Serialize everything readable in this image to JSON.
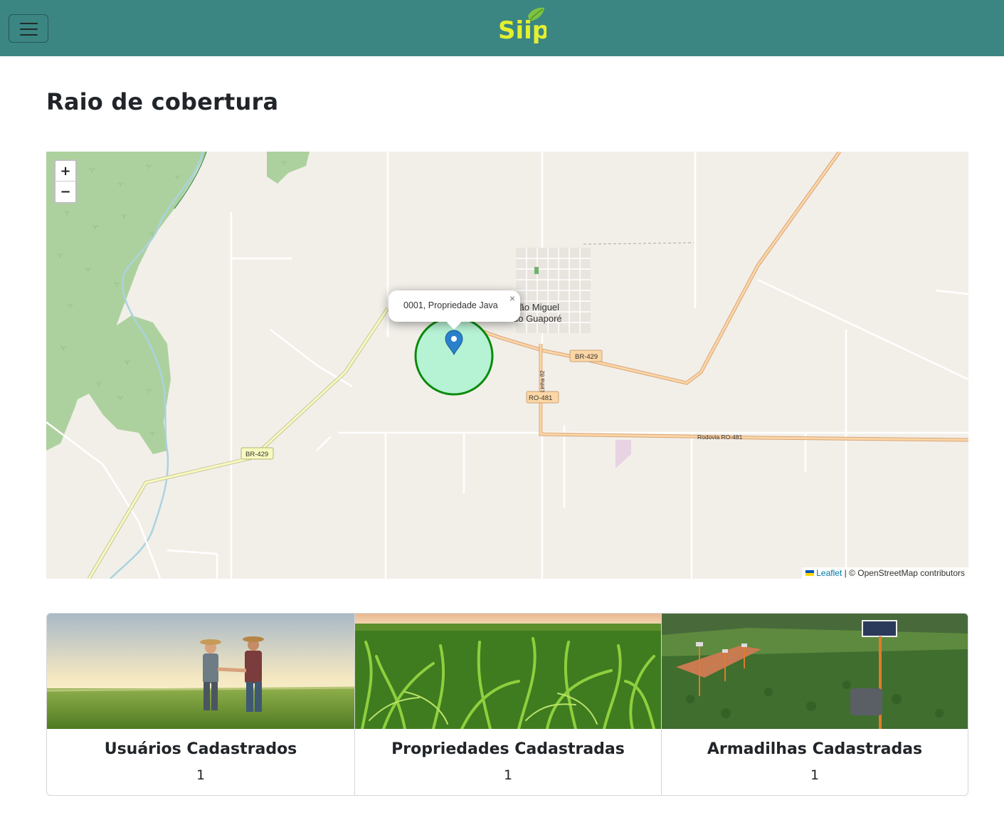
{
  "header": {
    "brand_name": "Siip",
    "menu_toggle_icon": "hamburger-menu-icon",
    "background_color": "#3b8683",
    "logo_color": "#e4ef2f",
    "leaf_color": "#7dc242"
  },
  "page": {
    "title": "Raio de cobertura"
  },
  "map": {
    "zoom_in_label": "+",
    "zoom_out_label": "−",
    "popup_text": "0001, Propriedade Java",
    "popup_close": "×",
    "marker_icon": "map-pin-icon",
    "coverage_fill": "#b6f2d4",
    "coverage_stroke": "#0a8a0a",
    "labels": {
      "town_line1": "São Miguel",
      "town_line2": "do Guaporé",
      "road_br429_east": "BR-429",
      "road_br429_west": "BR-429",
      "road_ro481": "RO-481",
      "road_linha82": "Linha 82",
      "road_rodovia_ro481": "Rodovia RO-481"
    },
    "attribution": {
      "leaflet": "Leaflet",
      "separator": " | © OpenStreetMap contributors"
    }
  },
  "stats": [
    {
      "title": "Usuários Cadastrados",
      "value": "1"
    },
    {
      "title": "Propriedades Cadastradas",
      "value": "1"
    },
    {
      "title": "Armadilhas Cadastradas",
      "value": "1"
    }
  ]
}
